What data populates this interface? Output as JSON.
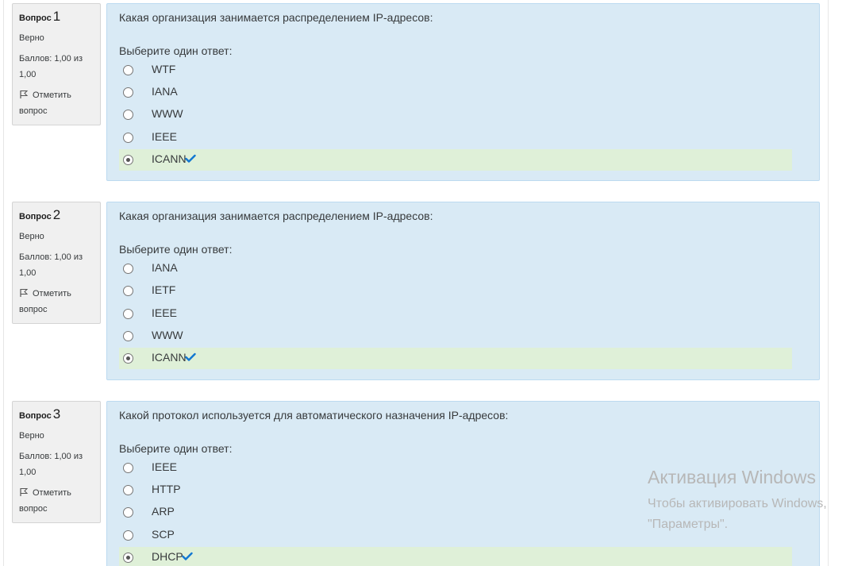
{
  "questions": [
    {
      "label": "Вопрос",
      "number": "1",
      "state": "Верно",
      "grade_line1": "Баллов: 1,00 из",
      "grade_line2": "1,00",
      "flag_line1": "Отметить",
      "flag_line2": "вопрос",
      "text": "Какая организация занимается распределением IP-адресов:",
      "prompt": "Выберите один ответ:",
      "answers": [
        {
          "label": "WTF",
          "selected": false,
          "correct": false
        },
        {
          "label": "IANA",
          "selected": false,
          "correct": false
        },
        {
          "label": "WWW",
          "selected": false,
          "correct": false
        },
        {
          "label": "IEEE",
          "selected": false,
          "correct": false
        },
        {
          "label": "ICANN",
          "selected": true,
          "correct": true
        }
      ]
    },
    {
      "label": "Вопрос",
      "number": "2",
      "state": "Верно",
      "grade_line1": "Баллов: 1,00 из",
      "grade_line2": "1,00",
      "flag_line1": "Отметить",
      "flag_line2": "вопрос",
      "text": "Какая организация занимается распределением IP-адресов:",
      "prompt": "Выберите один ответ:",
      "answers": [
        {
          "label": "IANA",
          "selected": false,
          "correct": false
        },
        {
          "label": "IETF",
          "selected": false,
          "correct": false
        },
        {
          "label": "IEEE",
          "selected": false,
          "correct": false
        },
        {
          "label": "WWW",
          "selected": false,
          "correct": false
        },
        {
          "label": "ICANN",
          "selected": true,
          "correct": true
        }
      ]
    },
    {
      "label": "Вопрос",
      "number": "3",
      "state": "Верно",
      "grade_line1": "Баллов: 1,00 из",
      "grade_line2": "1,00",
      "flag_line1": "Отметить",
      "flag_line2": "вопрос",
      "text": "Какой протокол используется для автоматического назначения IP-адресов:",
      "prompt": "Выберите один ответ:",
      "answers": [
        {
          "label": "IEEE",
          "selected": false,
          "correct": false
        },
        {
          "label": "HTTP",
          "selected": false,
          "correct": false
        },
        {
          "label": "ARP",
          "selected": false,
          "correct": false
        },
        {
          "label": "SCP",
          "selected": false,
          "correct": false
        },
        {
          "label": "DHCP",
          "selected": true,
          "correct": true
        }
      ]
    }
  ],
  "watermark": {
    "title": "Активация Windows",
    "line1": "Чтобы активировать Windows,",
    "line2": "\"Параметры\"."
  },
  "colors": {
    "content_bg": "#d9eaf5",
    "correct_bg": "#dff0d8",
    "check": "#1177d1",
    "info_bg": "#f0f0f0"
  },
  "icons": {
    "flag": "flag-icon",
    "check": "check-icon"
  }
}
